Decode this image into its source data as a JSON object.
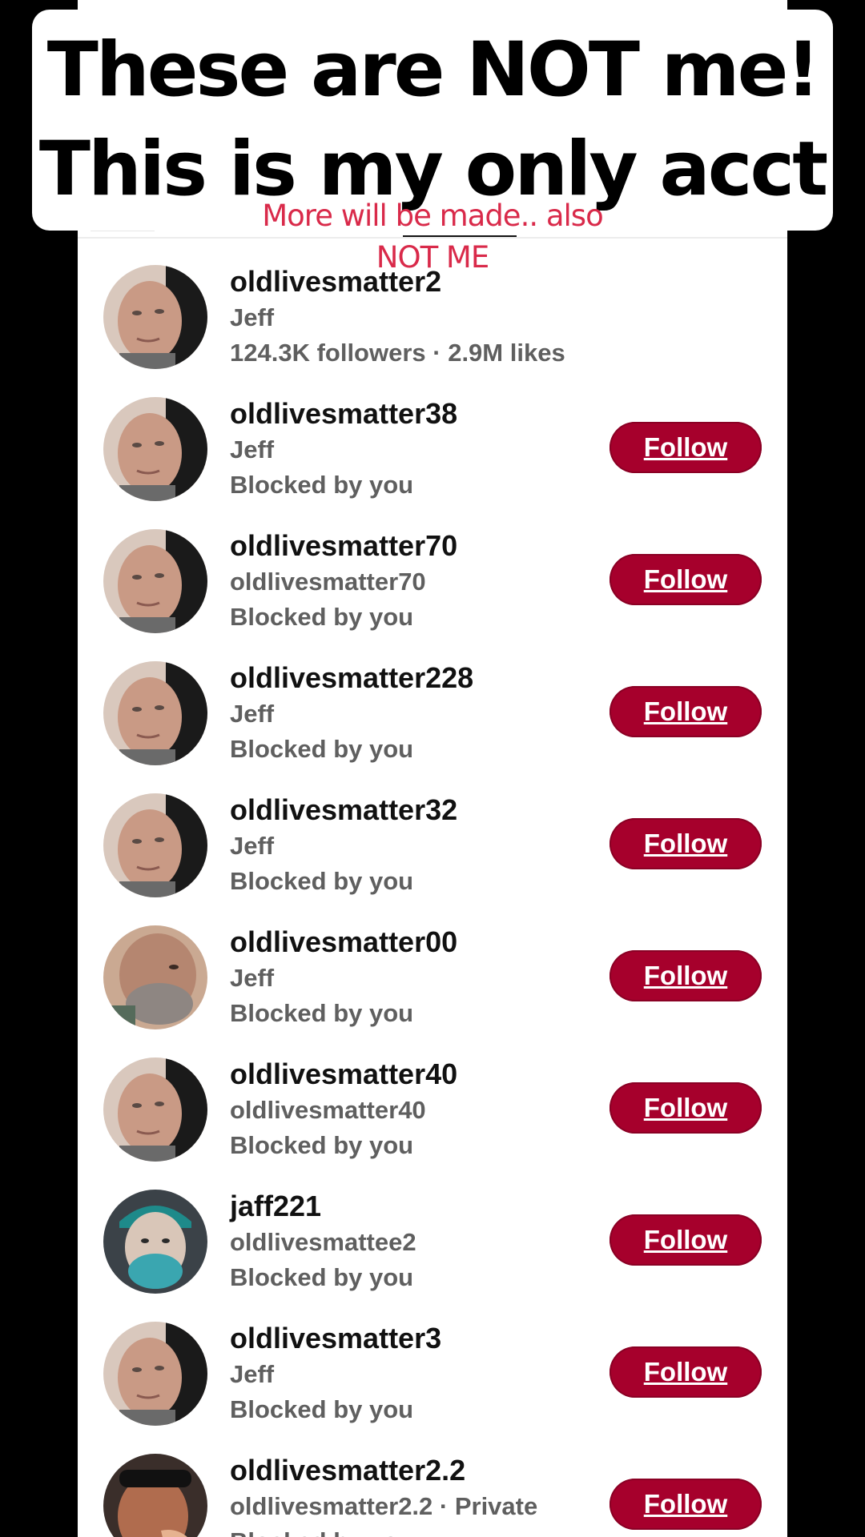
{
  "banner": {
    "line1": "These are NOT me!",
    "line2": "This is my only acct"
  },
  "overlay_note": "More will be made.. also NOT ME",
  "accent_color": "#a6002c",
  "note_color": "#d92a4a",
  "results": [
    {
      "username": "oldlivesmatter2",
      "display_name": "Jeff",
      "stat": "124.3K followers · 2.9M likes",
      "follow_label": "",
      "avatar": "avatar-a"
    },
    {
      "username": "oldlivesmatter38",
      "display_name": "Jeff",
      "stat": "Blocked by you",
      "follow_label": "Follow",
      "avatar": "avatar-a"
    },
    {
      "username": "oldlivesmatter70",
      "display_name": "oldlivesmatter70",
      "stat": "Blocked by you",
      "follow_label": "Follow",
      "avatar": "avatar-a"
    },
    {
      "username": "oldlivesmatter228",
      "display_name": "Jeff",
      "stat": "Blocked by you",
      "follow_label": "Follow",
      "avatar": "avatar-a"
    },
    {
      "username": "oldlivesmatter32",
      "display_name": "Jeff",
      "stat": "Blocked by you",
      "follow_label": "Follow",
      "avatar": "avatar-a"
    },
    {
      "username": "oldlivesmatter00",
      "display_name": "Jeff",
      "stat": "Blocked by you",
      "follow_label": "Follow",
      "avatar": "avatar-b"
    },
    {
      "username": "oldlivesmatter40",
      "display_name": "oldlivesmatter40",
      "stat": "Blocked by you",
      "follow_label": "Follow",
      "avatar": "avatar-a"
    },
    {
      "username": "jaff221",
      "display_name": "oldlivesmattee2",
      "stat": "Blocked by you",
      "follow_label": "Follow",
      "avatar": "avatar-c"
    },
    {
      "username": "oldlivesmatter3",
      "display_name": "Jeff",
      "stat": "Blocked by you",
      "follow_label": "Follow",
      "avatar": "avatar-a"
    },
    {
      "username": "oldlivesmatter2.2",
      "display_name": "oldlivesmatter2.2 · Private",
      "stat": "Blocked by you",
      "follow_label": "Follow",
      "avatar": "avatar-d"
    }
  ]
}
